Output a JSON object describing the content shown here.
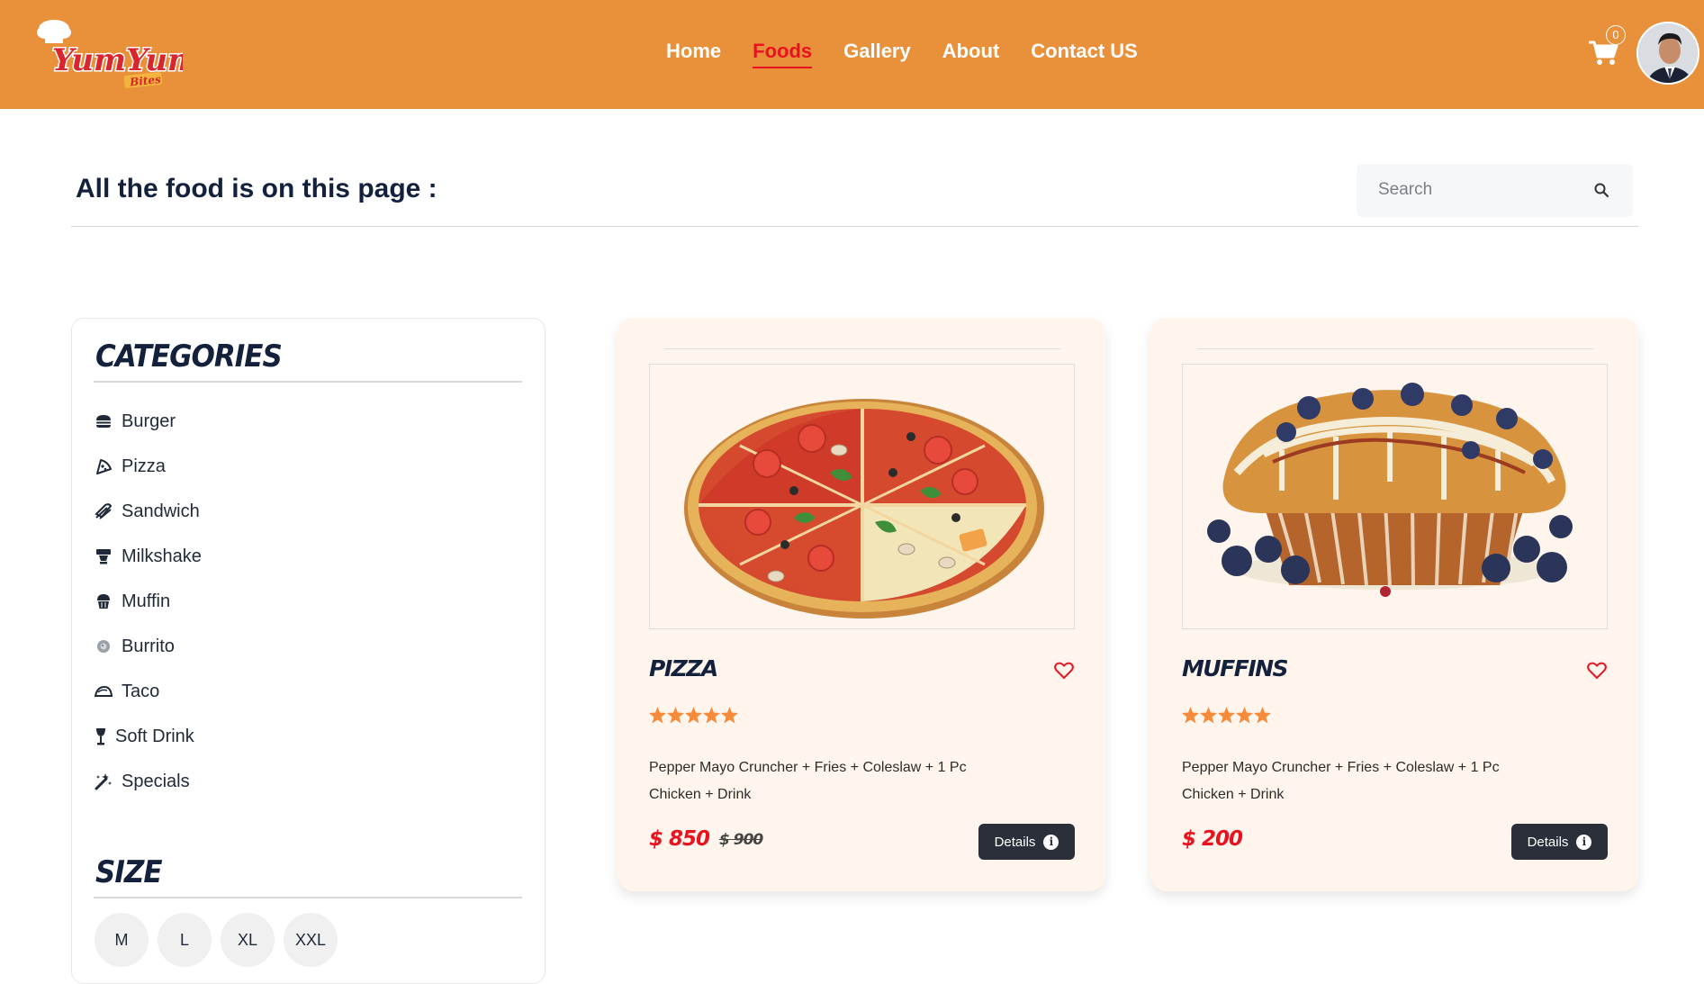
{
  "brand": {
    "logo_text": "YumYum",
    "logo_sub": "Bites"
  },
  "nav": {
    "items": [
      {
        "label": "Home",
        "active": false
      },
      {
        "label": "Foods",
        "active": true
      },
      {
        "label": "Gallery",
        "active": false
      },
      {
        "label": "About",
        "active": false
      },
      {
        "label": "Contact US",
        "active": false
      }
    ]
  },
  "cart": {
    "count": "0",
    "icon": "cart-icon"
  },
  "page": {
    "title": "All the food is on this page :"
  },
  "search": {
    "placeholder": "Search",
    "value": ""
  },
  "sidebar": {
    "categories_heading": "CATEGORIES",
    "categories": [
      {
        "label": "Burger",
        "icon": "burger-icon"
      },
      {
        "label": "Pizza",
        "icon": "pizza-icon"
      },
      {
        "label": "Sandwich",
        "icon": "sandwich-icon"
      },
      {
        "label": "Milkshake",
        "icon": "milkshake-icon"
      },
      {
        "label": "Muffin",
        "icon": "muffin-icon"
      },
      {
        "label": "Burrito",
        "icon": "burrito-icon"
      },
      {
        "label": "Taco",
        "icon": "taco-icon"
      },
      {
        "label": "Soft Drink",
        "icon": "soft-drink-icon"
      },
      {
        "label": "Specials",
        "icon": "magic-wand-icon"
      }
    ],
    "size_heading": "SIZE",
    "sizes": [
      "M",
      "L",
      "XL",
      "XXL"
    ]
  },
  "products": [
    {
      "name": "PIZZA",
      "rating": 5,
      "description": "Pepper Mayo Cruncher + Fries + Coleslaw + 1 Pc Chicken + Drink",
      "price": "$ 850",
      "old_price": "$ 900",
      "button_label": "Details"
    },
    {
      "name": "MUFFINS",
      "rating": 5,
      "description": "Pepper Mayo Cruncher + Fries + Coleslaw + 1 Pc Chicken + Drink",
      "price": "$ 200",
      "old_price": "",
      "button_label": "Details"
    }
  ],
  "colors": {
    "header": "#e8913a",
    "accent_red": "#e8131f",
    "star": "#f58b3a",
    "card_bg": "#fff5ec",
    "button_dark": "#2a2f3a"
  }
}
